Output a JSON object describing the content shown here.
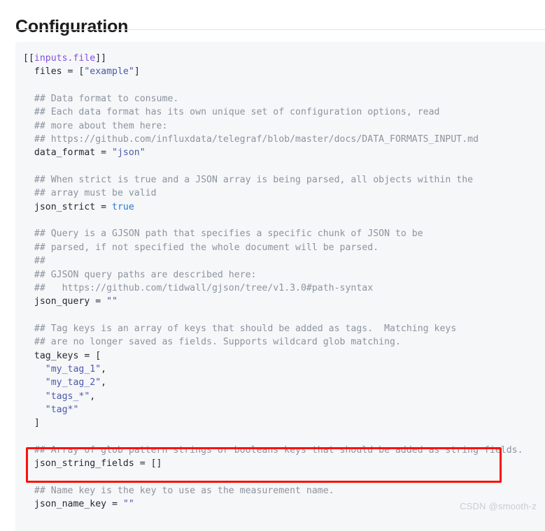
{
  "page": {
    "title": "Configuration",
    "watermark": "CSDN @smooth-z"
  },
  "colors": {
    "code_background": "#f6f7f9",
    "comment": "#8b949e",
    "table_header": "#8250df",
    "string": "#4b5aa8",
    "boolean": "#2a7ad4",
    "default_text": "#24292f",
    "highlight_border": "#fc1107",
    "rule": "#e3e3e5",
    "watermark": "#c9ccd1"
  },
  "code": {
    "language": "toml",
    "lines": [
      {
        "id": "l01",
        "segments": [
          {
            "t": "[[",
            "c": "punct"
          },
          {
            "t": "inputs.file",
            "c": "tbl"
          },
          {
            "t": "]]",
            "c": "punct"
          }
        ]
      },
      {
        "id": "l02",
        "segments": [
          {
            "t": "  files = [",
            "c": "key"
          },
          {
            "t": "\"example\"",
            "c": "str"
          },
          {
            "t": "]",
            "c": "key"
          }
        ]
      },
      {
        "id": "l03",
        "segments": [
          {
            "t": "",
            "c": "key"
          }
        ]
      },
      {
        "id": "l04",
        "segments": [
          {
            "t": "  ## Data format to consume.",
            "c": "cmt"
          }
        ]
      },
      {
        "id": "l05",
        "segments": [
          {
            "t": "  ## Each data format has its own unique set of configuration options, read",
            "c": "cmt"
          }
        ]
      },
      {
        "id": "l06",
        "segments": [
          {
            "t": "  ## more about them here:",
            "c": "cmt"
          }
        ]
      },
      {
        "id": "l07",
        "segments": [
          {
            "t": "  ## https://github.com/influxdata/telegraf/blob/master/docs/DATA_FORMATS_INPUT.md",
            "c": "cmt"
          }
        ]
      },
      {
        "id": "l08",
        "segments": [
          {
            "t": "  data_format = ",
            "c": "key"
          },
          {
            "t": "\"json\"",
            "c": "str"
          }
        ]
      },
      {
        "id": "l09",
        "segments": [
          {
            "t": "",
            "c": "key"
          }
        ]
      },
      {
        "id": "l10",
        "segments": [
          {
            "t": "  ## When strict is true and a JSON array is being parsed, all objects within the",
            "c": "cmt"
          }
        ]
      },
      {
        "id": "l11",
        "segments": [
          {
            "t": "  ## array must be valid",
            "c": "cmt"
          }
        ]
      },
      {
        "id": "l12",
        "segments": [
          {
            "t": "  json_strict = ",
            "c": "key"
          },
          {
            "t": "true",
            "c": "bool"
          }
        ]
      },
      {
        "id": "l13",
        "segments": [
          {
            "t": "",
            "c": "key"
          }
        ]
      },
      {
        "id": "l14",
        "segments": [
          {
            "t": "  ## Query is a GJSON path that specifies a specific chunk of JSON to be",
            "c": "cmt"
          }
        ]
      },
      {
        "id": "l15",
        "segments": [
          {
            "t": "  ## parsed, if not specified the whole document will be parsed.",
            "c": "cmt"
          }
        ]
      },
      {
        "id": "l16",
        "segments": [
          {
            "t": "  ##",
            "c": "cmt"
          }
        ]
      },
      {
        "id": "l17",
        "segments": [
          {
            "t": "  ## GJSON query paths are described here:",
            "c": "cmt"
          }
        ]
      },
      {
        "id": "l18",
        "segments": [
          {
            "t": "  ##   https://github.com/tidwall/gjson/tree/v1.3.0#path-syntax",
            "c": "cmt"
          }
        ]
      },
      {
        "id": "l19",
        "segments": [
          {
            "t": "  json_query = ",
            "c": "key"
          },
          {
            "t": "\"\"",
            "c": "str"
          }
        ]
      },
      {
        "id": "l20",
        "segments": [
          {
            "t": "",
            "c": "key"
          }
        ]
      },
      {
        "id": "l21",
        "segments": [
          {
            "t": "  ## Tag keys is an array of keys that should be added as tags.  Matching keys",
            "c": "cmt"
          }
        ]
      },
      {
        "id": "l22",
        "segments": [
          {
            "t": "  ## are no longer saved as fields. Supports wildcard glob matching.",
            "c": "cmt"
          }
        ]
      },
      {
        "id": "l23",
        "segments": [
          {
            "t": "  tag_keys = [",
            "c": "key"
          }
        ]
      },
      {
        "id": "l24",
        "segments": [
          {
            "t": "    ",
            "c": "key"
          },
          {
            "t": "\"my_tag_1\"",
            "c": "str"
          },
          {
            "t": ",",
            "c": "key"
          }
        ]
      },
      {
        "id": "l25",
        "segments": [
          {
            "t": "    ",
            "c": "key"
          },
          {
            "t": "\"my_tag_2\"",
            "c": "str"
          },
          {
            "t": ",",
            "c": "key"
          }
        ]
      },
      {
        "id": "l26",
        "segments": [
          {
            "t": "    ",
            "c": "key"
          },
          {
            "t": "\"tags_*\"",
            "c": "str"
          },
          {
            "t": ",",
            "c": "key"
          }
        ]
      },
      {
        "id": "l27",
        "segments": [
          {
            "t": "    ",
            "c": "key"
          },
          {
            "t": "\"tag*\"",
            "c": "str"
          }
        ]
      },
      {
        "id": "l28",
        "segments": [
          {
            "t": "  ]",
            "c": "key"
          }
        ]
      },
      {
        "id": "l29",
        "segments": [
          {
            "t": "",
            "c": "key"
          }
        ]
      },
      {
        "id": "l30",
        "segments": [
          {
            "t": "  ## Array of glob pattern strings or booleans keys that should be added as string fields.",
            "c": "cmt"
          }
        ]
      },
      {
        "id": "l31",
        "segments": [
          {
            "t": "  json_string_fields = []",
            "c": "key"
          }
        ]
      },
      {
        "id": "l32",
        "segments": [
          {
            "t": "",
            "c": "key"
          }
        ]
      },
      {
        "id": "l33",
        "segments": [
          {
            "t": "  ## Name key is the key to use as the measurement name.",
            "c": "cmt"
          }
        ]
      },
      {
        "id": "l34",
        "segments": [
          {
            "t": "  json_name_key = ",
            "c": "key"
          },
          {
            "t": "\"\"",
            "c": "str"
          }
        ]
      }
    ]
  },
  "annotation": {
    "type": "red-rectangle-highlight",
    "target_lines": [
      "l30",
      "l31"
    ],
    "label": "json_string_fields"
  }
}
